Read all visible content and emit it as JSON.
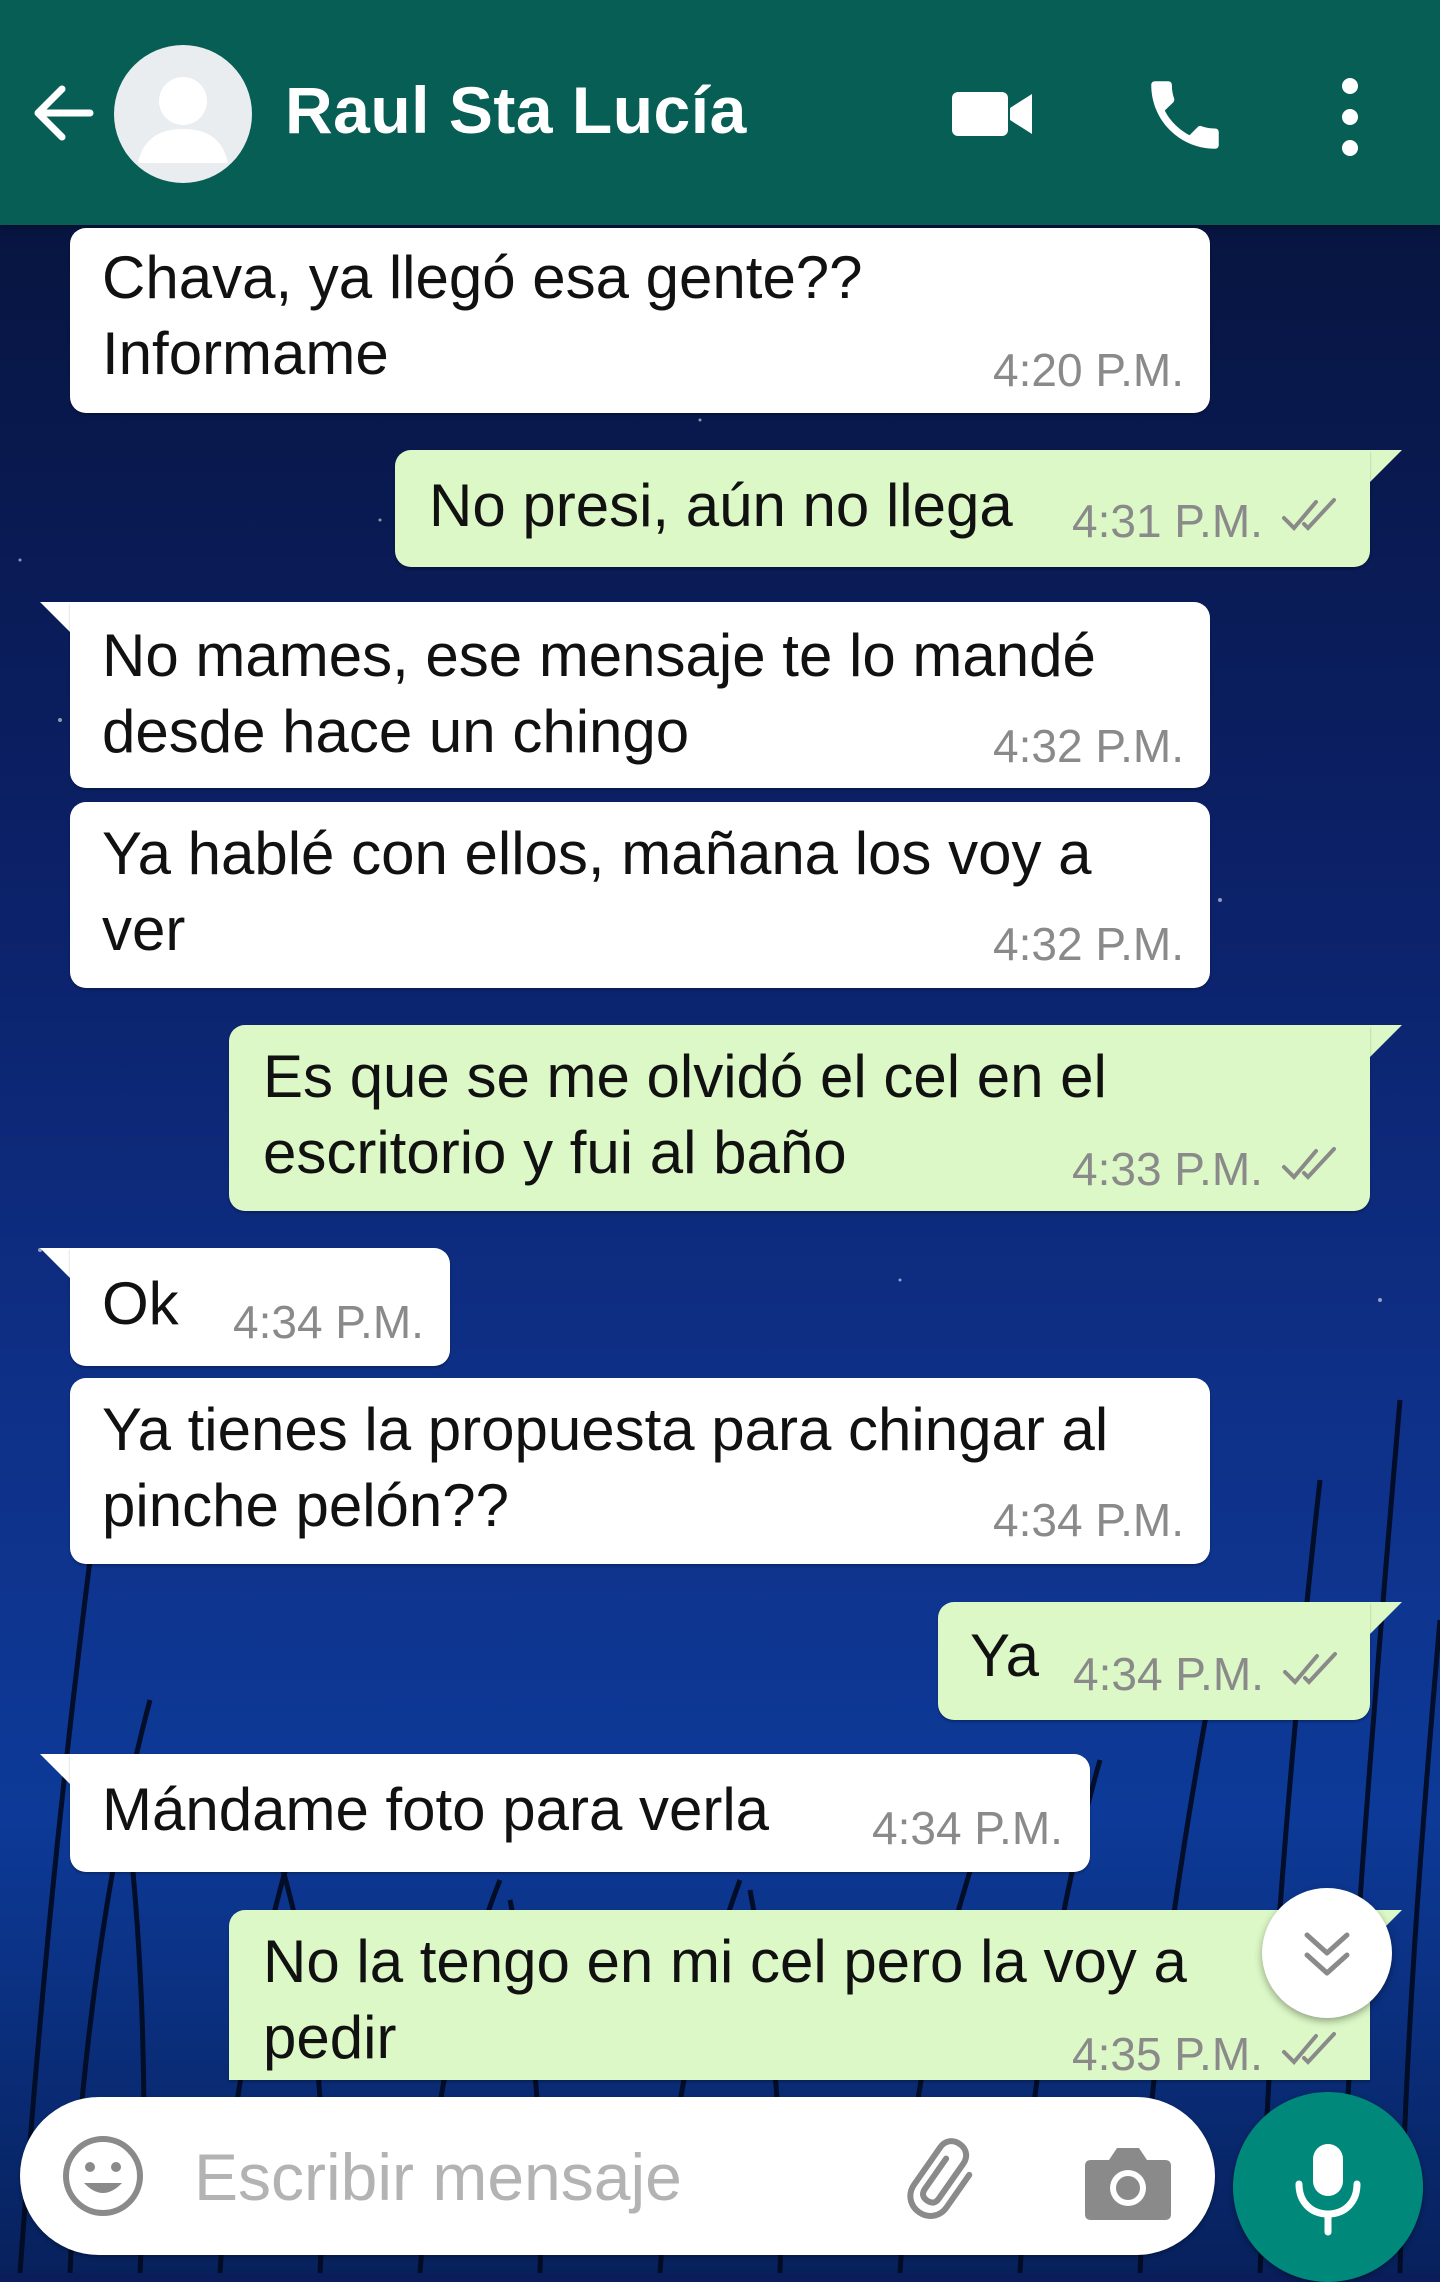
{
  "header": {
    "contact_name": "Raul Sta Lucía",
    "icons": [
      "back-arrow-icon",
      "avatar-placeholder-icon",
      "video-call-icon",
      "phone-icon",
      "more-vert-icon"
    ],
    "color": "#075e54"
  },
  "messages": [
    {
      "direction": "in",
      "text": "Chava, ya llegó esa gente??\nInformame",
      "time": "4:20 P.M."
    },
    {
      "direction": "out",
      "text": "No presi, aún no llega",
      "time": "4:31 P.M."
    },
    {
      "direction": "in",
      "text": "No mames, ese mensaje te lo mandé\ndesde hace un chingo",
      "time": "4:32 P.M."
    },
    {
      "direction": "in",
      "text": "Ya hablé con ellos, mañana los voy a\nver",
      "time": "4:32 P.M."
    },
    {
      "direction": "out",
      "text": "Es que se me olvidó el cel en el\nescritorio y fui al baño",
      "time": "4:33 P.M."
    },
    {
      "direction": "in",
      "text": "Ok",
      "time": "4:34 P.M."
    },
    {
      "direction": "in",
      "text": "Ya tienes la propuesta para chingar al\npinche pelón??",
      "time": "4:34 P.M."
    },
    {
      "direction": "out",
      "text": "Ya",
      "time": "4:34 P.M."
    },
    {
      "direction": "in",
      "text": "Mándame foto para verla",
      "time": "4:34 P.M."
    },
    {
      "direction": "out",
      "text": "No la tengo en mi cel pero la voy a\npedir",
      "time": "4:35 P.M."
    }
  ],
  "composer": {
    "placeholder": "Escribir mensaje",
    "icons": [
      "emoji-icon",
      "attach-icon",
      "camera-icon",
      "mic-icon",
      "scroll-down-icon"
    ]
  },
  "colors": {
    "incoming_bubble": "#ffffff",
    "outgoing_bubble": "#dcf8c6",
    "mic_button": "#00897b",
    "timestamp": "#8a8a8a",
    "read_ticks": "#8a8a8a"
  }
}
